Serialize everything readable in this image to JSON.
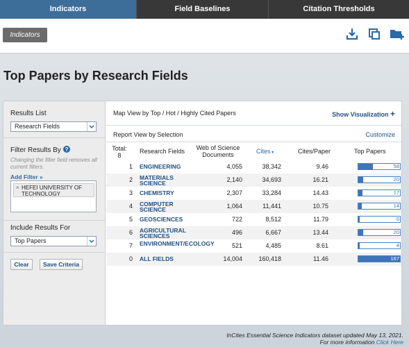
{
  "nav": {
    "tabs": [
      "Indicators",
      "Field Baselines",
      "Citation Thresholds"
    ]
  },
  "toolbar": {
    "breadcrumb": "Indicators",
    "icons": [
      "download-icon",
      "print-icon",
      "add-folder-icon"
    ]
  },
  "page": {
    "title": "Top Papers by Research Fields"
  },
  "sidebar": {
    "results_list_label": "Results List",
    "results_list_value": "Research Fields",
    "filter_label": "Filter Results By",
    "filter_hint": "Changing the filter field removes all current filters.",
    "add_filter": "Add Filter »",
    "filter_chip": "HEFEI UNIVERSITY OF TECHNOLOGY",
    "include_label": "Include Results For",
    "include_value": "Top Papers",
    "clear_button": "Clear",
    "save_button": "Save Criteria"
  },
  "content": {
    "map_view": "Map View by Top / Hot / Highly Cited Papers",
    "show_viz": "Show Visualization",
    "report_view": "Report View by Selection",
    "customize": "Customize",
    "total_label": "Total:",
    "total_value": "8",
    "columns": {
      "fields": "Research Fields",
      "wos": "Web of Science Documents",
      "cites": "Cites",
      "cpp": "Cites/Paper",
      "top": "Top Papers"
    },
    "rows": [
      {
        "rank": "1",
        "field": "ENGINEERING",
        "wos": "4,055",
        "cites": "38,342",
        "cpp": "9.46",
        "top": "58",
        "frac": 0.347
      },
      {
        "rank": "2",
        "field": "MATERIALS SCIENCE",
        "wos": "2,140",
        "cites": "34,693",
        "cpp": "16.21",
        "top": "20",
        "frac": 0.12
      },
      {
        "rank": "3",
        "field": "CHEMISTRY",
        "wos": "2,307",
        "cites": "33,284",
        "cpp": "14.43",
        "top": "17",
        "frac": 0.102
      },
      {
        "rank": "4",
        "field": "COMPUTER SCIENCE",
        "wos": "1,064",
        "cites": "11,441",
        "cpp": "10.75",
        "top": "14",
        "frac": 0.084
      },
      {
        "rank": "5",
        "field": "GEOSCIENCES",
        "wos": "722",
        "cites": "8,512",
        "cpp": "11.79",
        "top": "6",
        "frac": 0.036
      },
      {
        "rank": "6",
        "field": "AGRICULTURAL SCIENCES",
        "wos": "496",
        "cites": "6,667",
        "cpp": "13.44",
        "top": "20",
        "frac": 0.12
      },
      {
        "rank": "7",
        "field": "ENVIRONMENT/ECOLOGY",
        "wos": "521",
        "cites": "4,485",
        "cpp": "8.61",
        "top": "4",
        "frac": 0.024
      },
      {
        "rank": "0",
        "field": "ALL FIELDS",
        "wos": "14,004",
        "cites": "160,418",
        "cpp": "11.46",
        "top": "167",
        "frac": 1.0
      }
    ]
  },
  "footer": {
    "line1": "InCites Essential Science Indicators dataset updated May 13, 2021.",
    "line2_prefix": "For more information",
    "line2_link": "Click Here"
  },
  "colors": {
    "accent": "#3d6e99",
    "link": "#1f4f82",
    "bar": "#3f74b8"
  }
}
